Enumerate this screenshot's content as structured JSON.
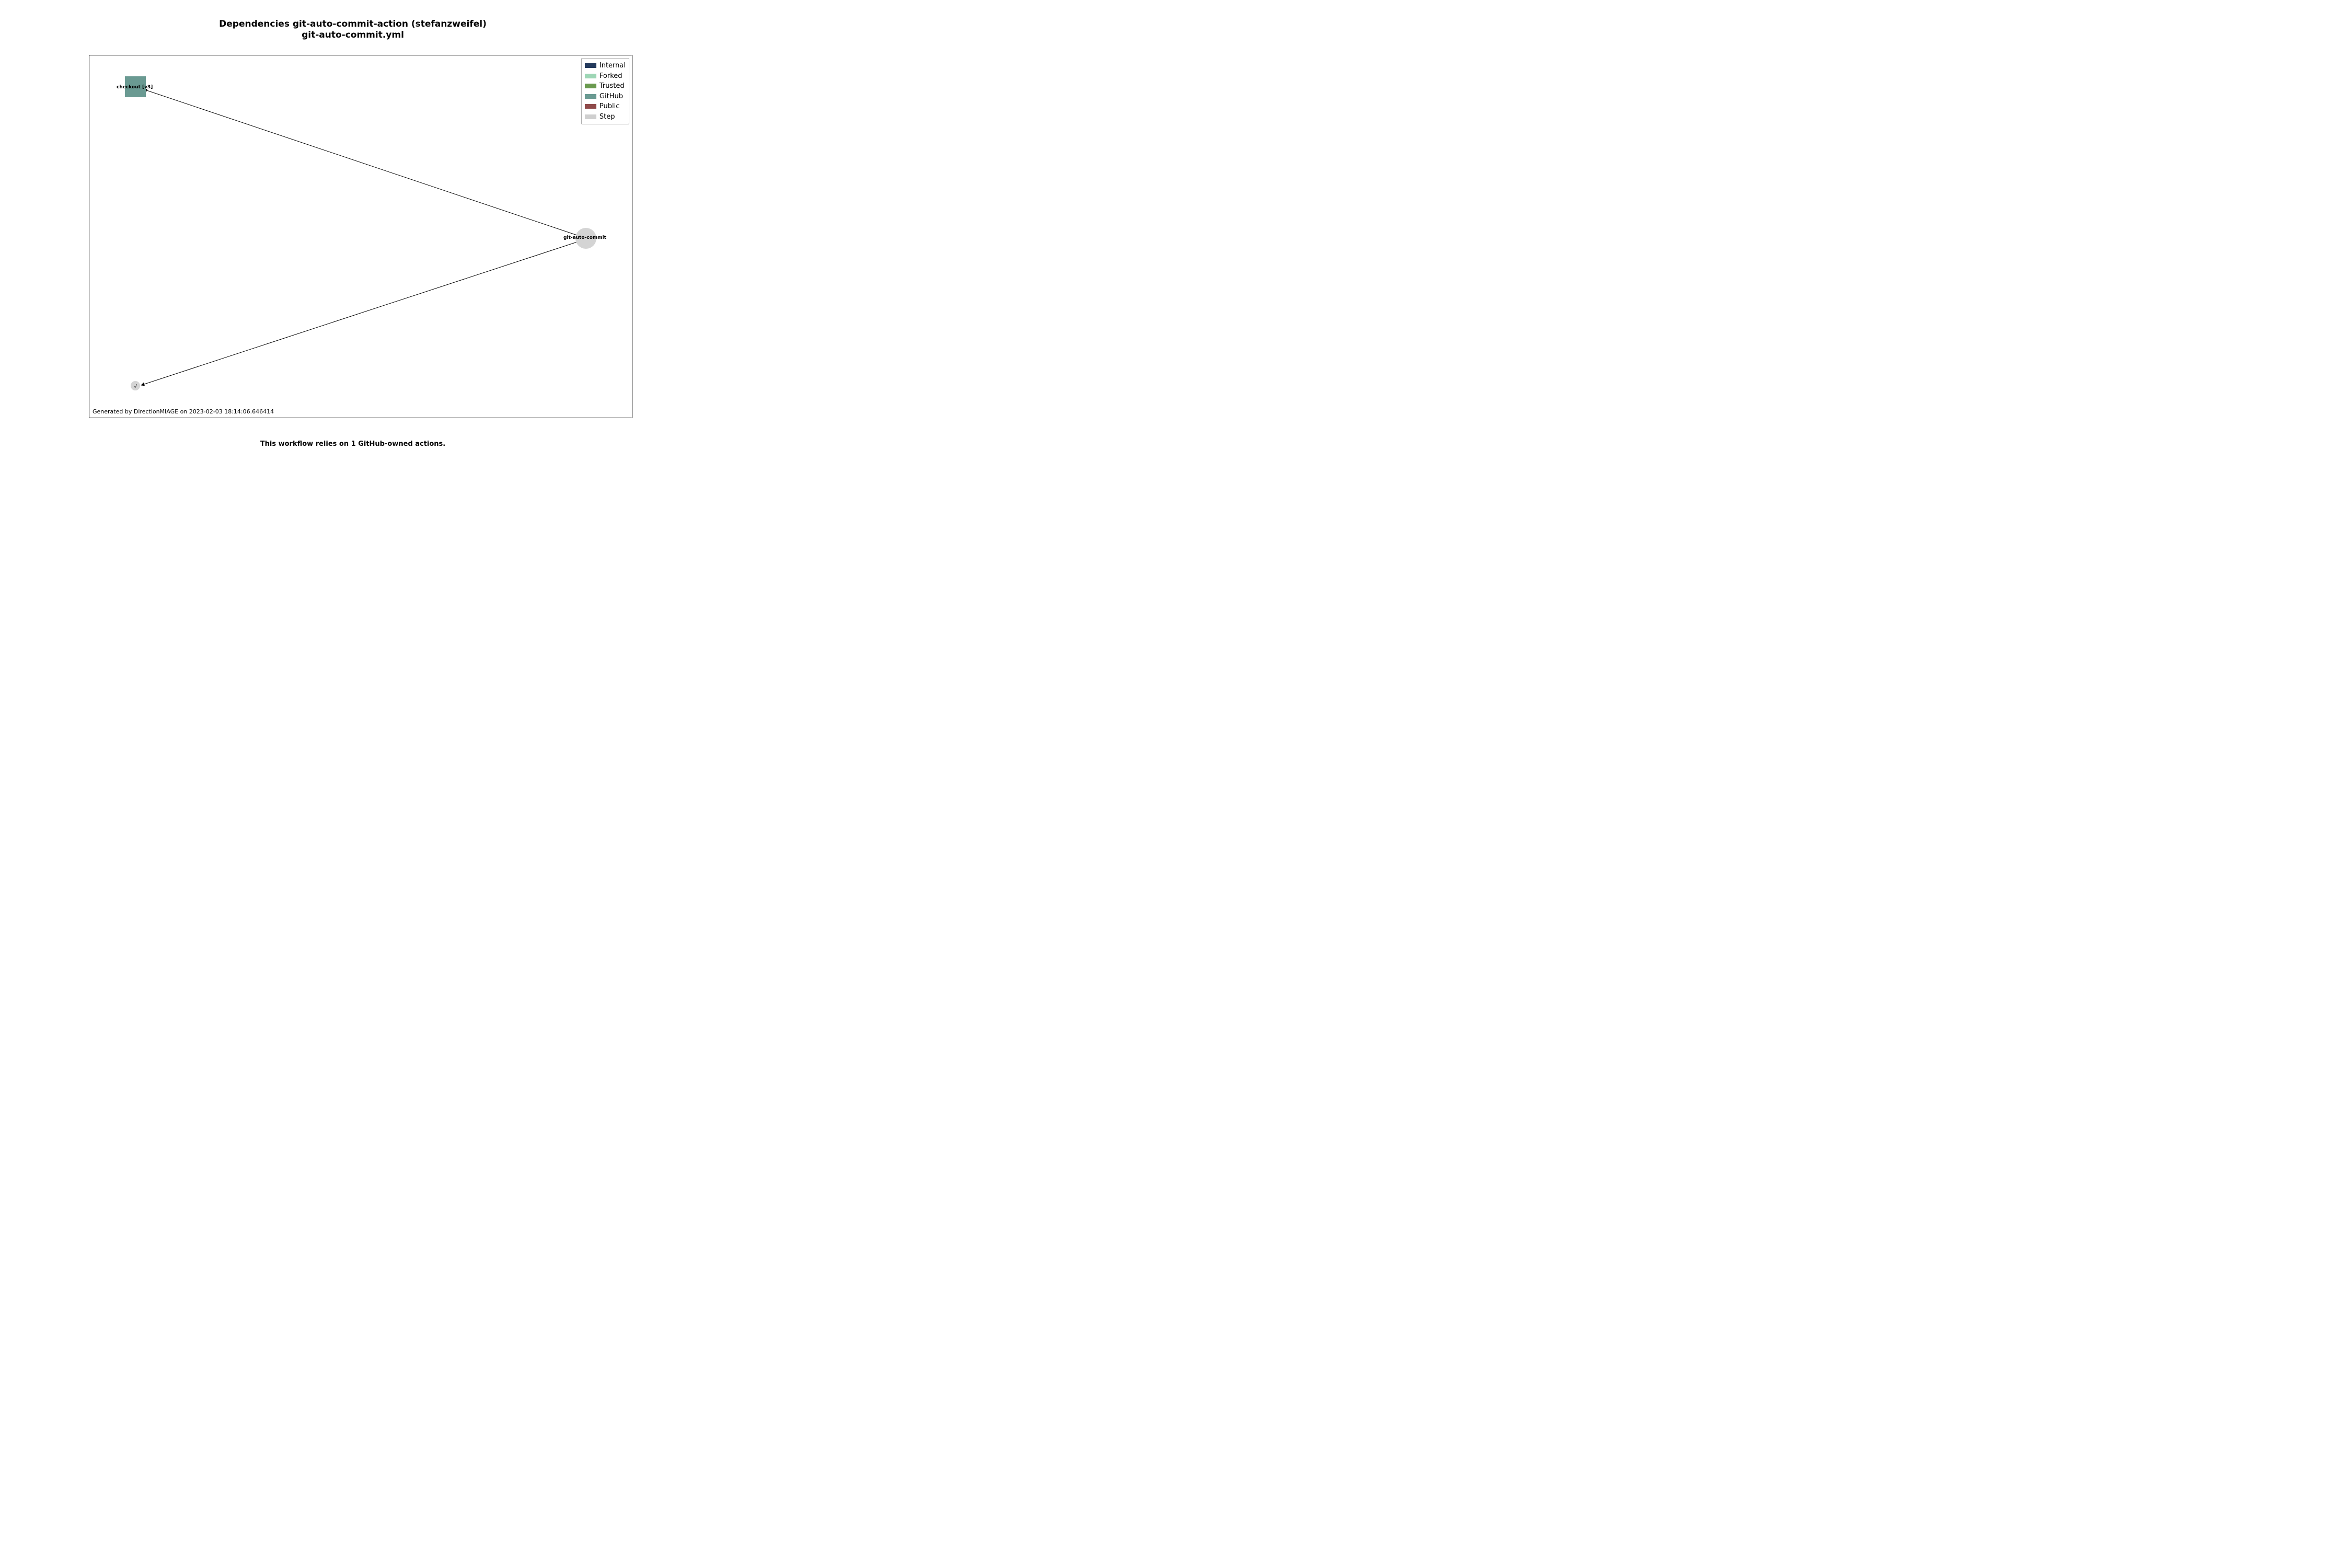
{
  "title_line1": "Dependencies git-auto-commit-action (stefanzweifel)",
  "title_line2": "git-auto-commit.yml",
  "nodes": {
    "checkout": {
      "label": "checkout [v3]",
      "color": "#6a9a92"
    },
    "root": {
      "label": "git-auto-commit",
      "color": "#d4d4d4"
    },
    "local": {
      "label": "./",
      "color": "#d4d4d4"
    }
  },
  "legend": [
    {
      "label": "Internal",
      "color": "#233a5c"
    },
    {
      "label": "Forked",
      "color": "#9dd6b5"
    },
    {
      "label": "Trusted",
      "color": "#6a9a4f"
    },
    {
      "label": "GitHub",
      "color": "#6a9a92"
    },
    {
      "label": "Public",
      "color": "#8f4a4a"
    },
    {
      "label": "Step",
      "color": "#cfcfcf"
    }
  ],
  "footer": "Generated by DirectionMIAGE on 2023-02-03 18:14:06.646414",
  "caption": "This workflow relies on 1 GitHub-owned actions.",
  "chart_data": {
    "type": "network",
    "title": "Dependencies git-auto-commit-action (stefanzweifel) — git-auto-commit.yml",
    "nodes": [
      {
        "id": "git-auto-commit",
        "kind": "Step",
        "shape": "circle",
        "x": 0.92,
        "y": 0.505
      },
      {
        "id": "checkout [v3]",
        "kind": "GitHub",
        "shape": "square",
        "x": 0.085,
        "y": 0.085
      },
      {
        "id": "./",
        "kind": "Step",
        "shape": "circle",
        "x": 0.085,
        "y": 0.91
      }
    ],
    "edges": [
      {
        "from": "git-auto-commit",
        "to": "checkout [v3]",
        "directed": true
      },
      {
        "from": "git-auto-commit",
        "to": "./",
        "directed": true
      }
    ],
    "legend_categories": [
      "Internal",
      "Forked",
      "Trusted",
      "GitHub",
      "Public",
      "Step"
    ],
    "footer": "Generated by DirectionMIAGE on 2023-02-03 18:14:06.646414",
    "caption": "This workflow relies on 1 GitHub-owned actions."
  }
}
